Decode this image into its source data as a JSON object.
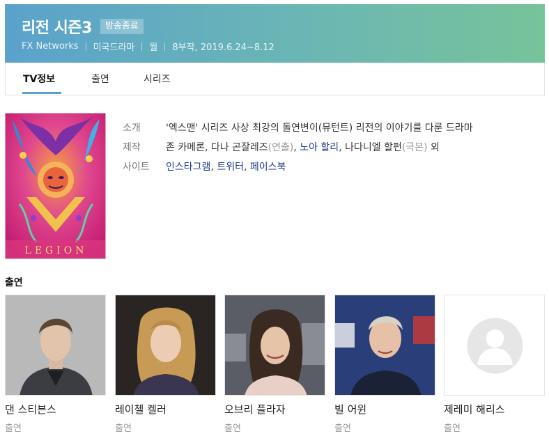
{
  "program": {
    "title": "리전 시즌3",
    "status_badge": "방송종료",
    "meta": [
      "FX Networks",
      "미국드라마",
      "월",
      "8부작, 2019.6.24~8.12"
    ]
  },
  "tabs": [
    {
      "label": "TV정보",
      "active": true
    },
    {
      "label": "출연",
      "active": false
    },
    {
      "label": "시리즈",
      "active": false
    }
  ],
  "poster": {
    "text": "LEGION"
  },
  "info": {
    "intro_label": "소개",
    "intro_text": "'엑스맨' 시리즈 사상 최강의 돌연변이(뮤턴트) 리전의 이야기를 다룬 드라마",
    "production_label": "제작",
    "production": {
      "person1": "존 카메론",
      "comma1": ", ",
      "person2": "다나 곤잘레즈",
      "role2": "(연출)",
      "comma2": ", ",
      "person3": "노아 할리",
      "comma3": ", ",
      "person4": "나다니엘 할펀",
      "role4": "(극본)",
      "suffix": " 외"
    },
    "site_label": "사이트",
    "sites": {
      "a": "인스타그램",
      "comma1": ", ",
      "b": "트위터",
      "comma2": ", ",
      "c": "페이스북"
    }
  },
  "cast": {
    "heading": "출연",
    "members": [
      {
        "name": "댄 스티븐스",
        "role": "출연"
      },
      {
        "name": "레이첼 켈러",
        "role": "출연"
      },
      {
        "name": "오브리 플라자",
        "role": "출연"
      },
      {
        "name": "빌 어윈",
        "role": "출연"
      },
      {
        "name": "제레미 해리스",
        "role": "출연"
      }
    ]
  },
  "colors": {
    "header_start": "#5aa2cc",
    "header_end": "#77c39a",
    "link": "#1a3a8c"
  }
}
